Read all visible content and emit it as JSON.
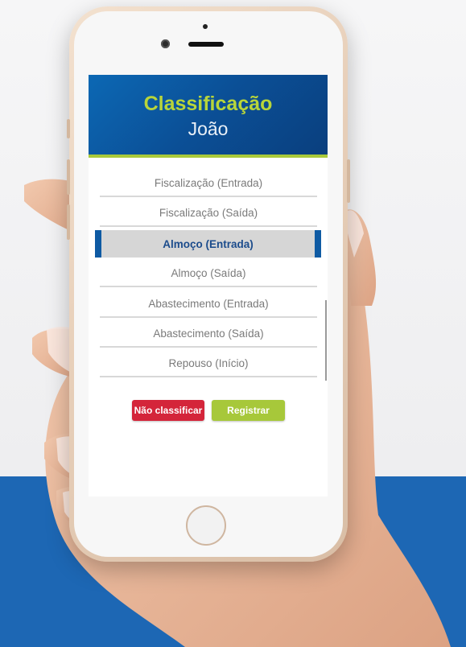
{
  "header": {
    "title": "Classificação",
    "subtitle": "João"
  },
  "options": [
    {
      "label": "Fiscalização (Entrada)",
      "selected": false
    },
    {
      "label": "Fiscalização (Saída)",
      "selected": false
    },
    {
      "label": "Almoço (Entrada)",
      "selected": true
    },
    {
      "label": "Almoço (Saída)",
      "selected": false
    },
    {
      "label": "Abastecimento (Entrada)",
      "selected": false
    },
    {
      "label": "Abastecimento (Saída)",
      "selected": false
    },
    {
      "label": "Repouso (Início)",
      "selected": false
    }
  ],
  "buttons": {
    "skip_label": "Não classificar",
    "register_label": "Registrar"
  },
  "colors": {
    "header_blue": "#0b4f96",
    "title_green": "#b8d53a",
    "accent_green": "#a9c93a",
    "selected_text": "#1c4c8c",
    "skip_red": "#d4253a",
    "register_green": "#a7c83a",
    "band_blue": "#1d67b4"
  }
}
